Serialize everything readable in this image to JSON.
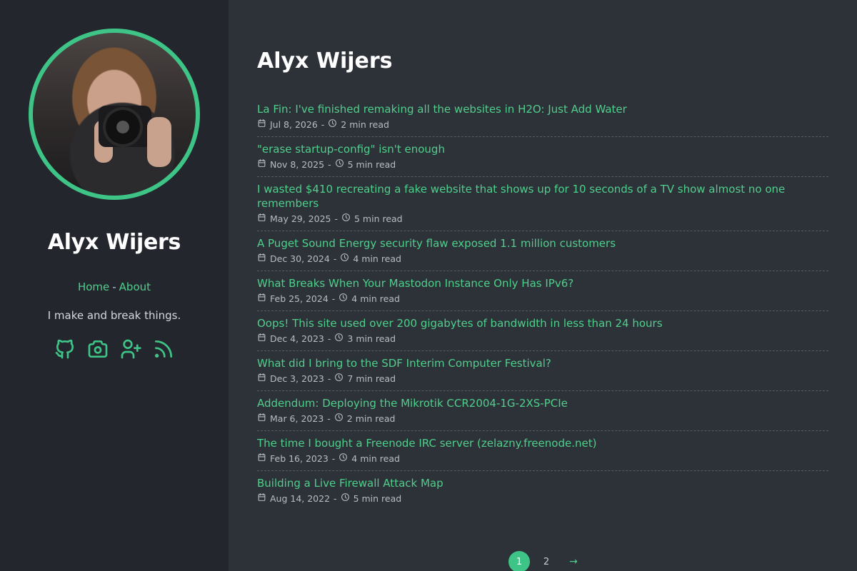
{
  "sidebar": {
    "site_name": "Alyx Wijers",
    "nav": {
      "home": "Home",
      "separator": "-",
      "about": "About"
    },
    "tagline": "I make and break things.",
    "socials": [
      {
        "icon": "github-icon"
      },
      {
        "icon": "camera-icon"
      },
      {
        "icon": "user-plus-icon"
      },
      {
        "icon": "rss-icon"
      }
    ]
  },
  "main": {
    "title": "Alyx Wijers",
    "posts": [
      {
        "title": "La Fin: I've finished remaking all the websites in H2O: Just Add Water",
        "date": "Jul 8, 2026",
        "read": "2 min read"
      },
      {
        "title": "\"erase startup-config\" isn't enough",
        "date": "Nov 8, 2025",
        "read": "5 min read"
      },
      {
        "title": "I wasted $410 recreating a fake website that shows up for 10 seconds of a TV show almost no one remembers",
        "date": "May 29, 2025",
        "read": "5 min read"
      },
      {
        "title": "A Puget Sound Energy security flaw exposed 1.1 million customers",
        "date": "Dec 30, 2024",
        "read": "4 min read"
      },
      {
        "title": "What Breaks When Your Mastodon Instance Only Has IPv6?",
        "date": "Feb 25, 2024",
        "read": "4 min read"
      },
      {
        "title": "Oops! This site used over 200 gigabytes of bandwidth in less than 24 hours",
        "date": "Dec 4, 2023",
        "read": "3 min read"
      },
      {
        "title": "What did I bring to the SDF Interim Computer Festival?",
        "date": "Dec 3, 2023",
        "read": "7 min read"
      },
      {
        "title": "Addendum: Deploying the Mikrotik CCR2004-1G-2XS-PCIe",
        "date": "Mar 6, 2023",
        "read": "2 min read"
      },
      {
        "title": "The time I bought a Freenode IRC server (zelazny.freenode.net)",
        "date": "Feb 16, 2023",
        "read": "4 min read"
      },
      {
        "title": "Building a Live Firewall Attack Map",
        "date": "Aug 14, 2022",
        "read": "5 min read"
      }
    ],
    "meta_separator": "-",
    "pagination": {
      "pages": [
        "1",
        "2"
      ],
      "current": "1",
      "next": "→"
    }
  },
  "colors": {
    "accent": "#3ec486",
    "link": "#4fcf8c",
    "sidebar_bg": "#23262d",
    "main_bg": "#2d3138"
  }
}
